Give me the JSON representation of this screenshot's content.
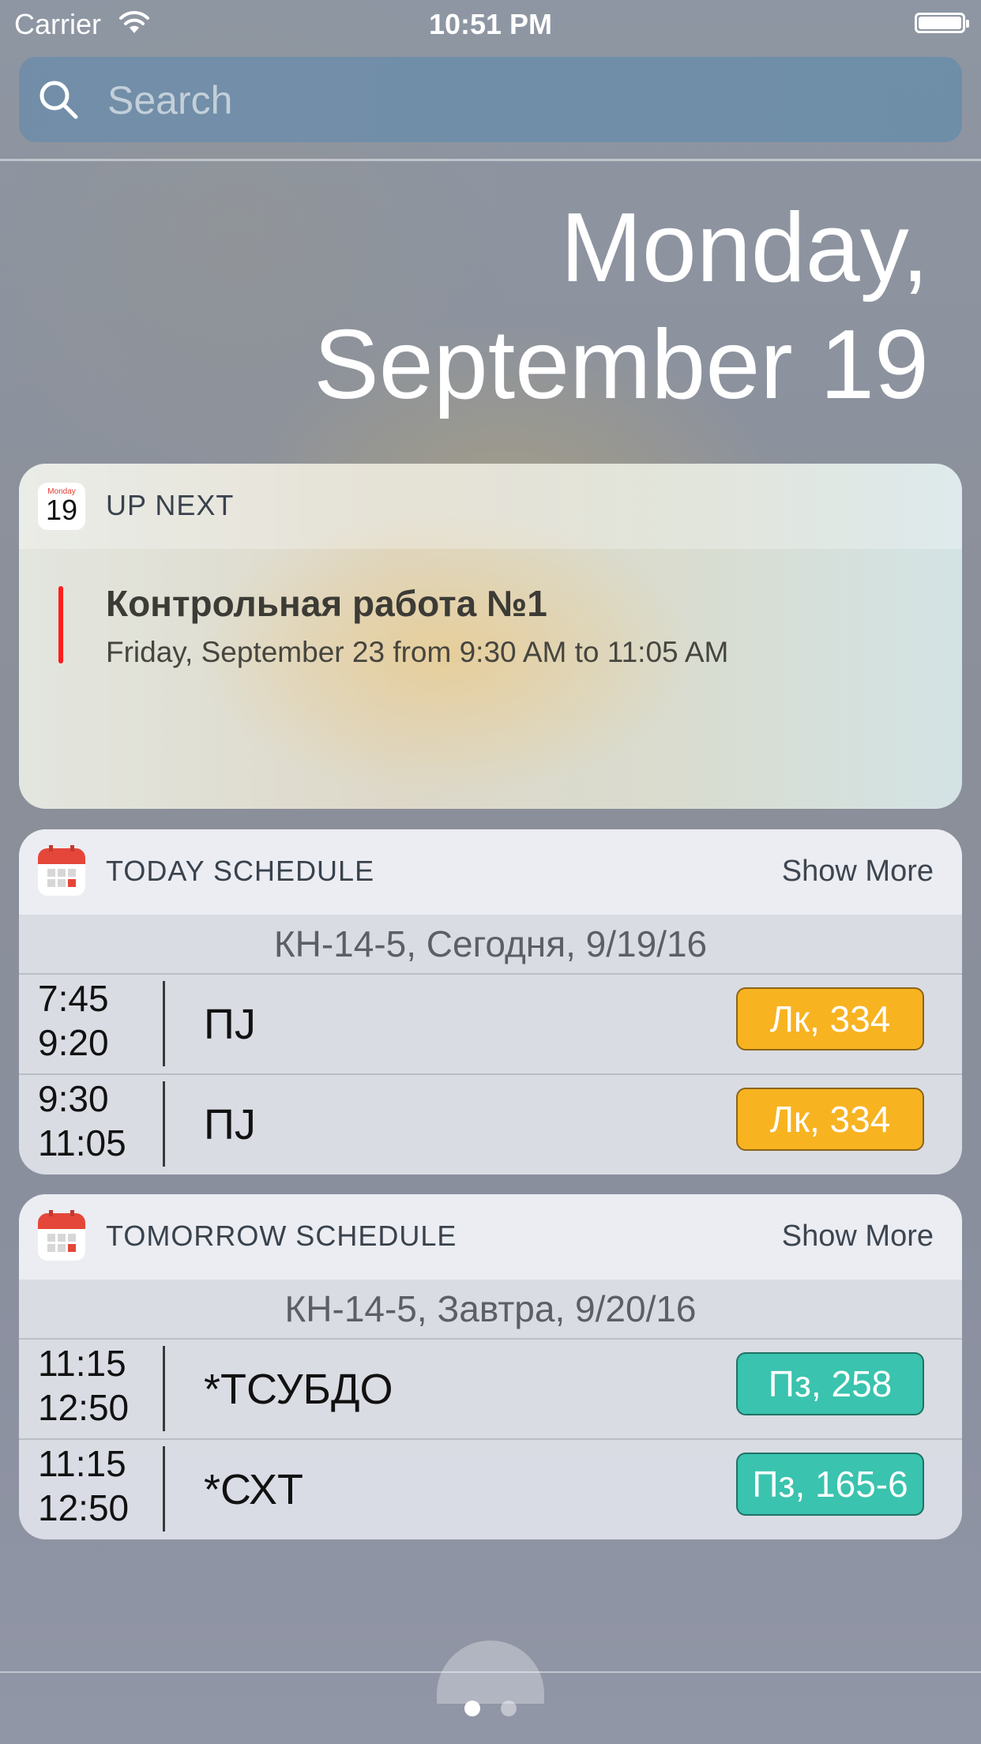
{
  "status_bar": {
    "carrier": "Carrier",
    "time": "10:51 PM"
  },
  "search": {
    "placeholder": "Search"
  },
  "date": {
    "line1": "Monday,",
    "line2": "September 19"
  },
  "up_next": {
    "title": "UP NEXT",
    "icon_month": "Monday",
    "icon_day": "19",
    "event_title": "Контрольная работа №1",
    "event_time": "Friday, September 23 from 9:30 AM to 11:05 AM",
    "event_color": "#ff1e1e"
  },
  "today": {
    "title": "TODAY SCHEDULE",
    "show_more": "Show More",
    "group": "КН-14-5, Сегодня, 9/19/16",
    "rows": [
      {
        "start": "7:45",
        "end": "9:20",
        "subject": "ПJ",
        "room": "Лк, 334"
      },
      {
        "start": "9:30",
        "end": "11:05",
        "subject": "ПJ",
        "room": "Лк, 334"
      }
    ]
  },
  "tomorrow": {
    "title": "TOMORROW SCHEDULE",
    "show_more": "Show More",
    "group": "КН-14-5, Завтра, 9/20/16",
    "rows": [
      {
        "start": "11:15",
        "end": "12:50",
        "subject": "*ТСУБДО",
        "room": "Пз, 258"
      },
      {
        "start": "11:15",
        "end": "12:50",
        "subject": "*СХТ",
        "room": "Пз, 165-6"
      }
    ]
  },
  "colors": {
    "lecture_badge": "#f8b321",
    "practice_badge": "#3ac3ae"
  },
  "page_indicator": {
    "count": 2,
    "active": 1
  }
}
